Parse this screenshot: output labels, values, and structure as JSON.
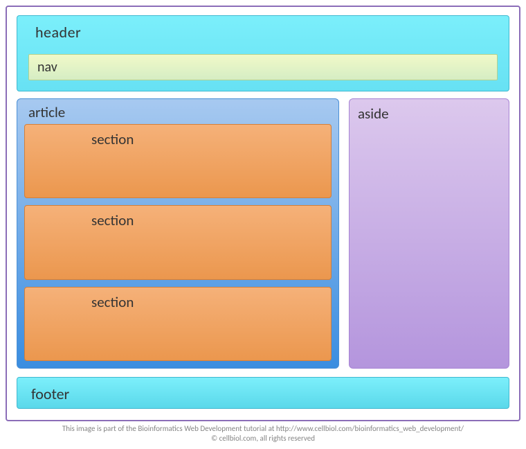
{
  "header": {
    "label": "header"
  },
  "nav": {
    "label": "nav"
  },
  "article": {
    "label": "article",
    "sections": [
      {
        "label": "section"
      },
      {
        "label": "section"
      },
      {
        "label": "section"
      }
    ]
  },
  "aside": {
    "label": "aside"
  },
  "footer": {
    "label": "footer"
  },
  "attribution": {
    "line1": "This image is part of the Bioinformatics Web Development tutorial at  http://www.cellbiol.com/bioinformatics_web_development/",
    "line2": "© cellbiol.com, all rights reserved"
  }
}
